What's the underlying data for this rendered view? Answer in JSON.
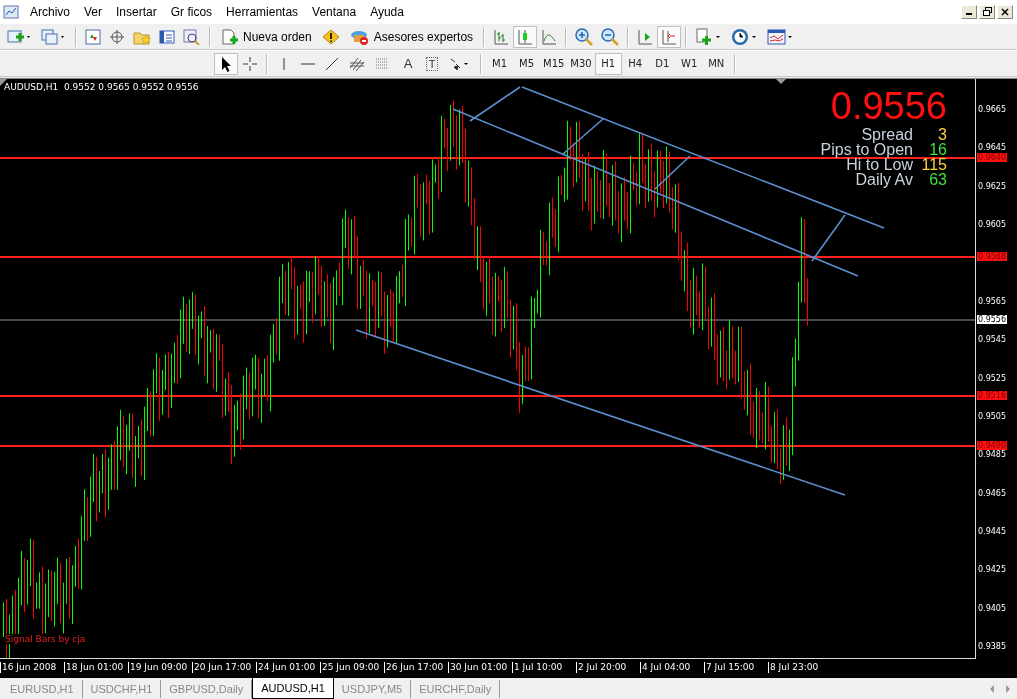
{
  "menu": {
    "items": [
      "Archivo",
      "Ver",
      "Insertar",
      "Gr ficos",
      "Herramientas",
      "Ventana",
      "Ayuda"
    ]
  },
  "toolbar": {
    "new_order": "Nueva orden",
    "experts": "Asesores expertos",
    "chart_types": [
      {
        "selected": false
      },
      {
        "selected": true
      },
      {
        "selected": false
      }
    ],
    "chart_shift": {
      "selected": false
    },
    "auto_scroll": {
      "selected": true
    }
  },
  "drawing_toolbar": {
    "cursor": {
      "selected": true
    },
    "text_tool": "A",
    "label_tool": "T",
    "timeframes": [
      {
        "label": "M1",
        "selected": false
      },
      {
        "label": "M5",
        "selected": false
      },
      {
        "label": "M15",
        "selected": false
      },
      {
        "label": "M30",
        "selected": false
      },
      {
        "label": "H1",
        "selected": true
      },
      {
        "label": "H4",
        "selected": false
      },
      {
        "label": "D1",
        "selected": false
      },
      {
        "label": "W1",
        "selected": false
      },
      {
        "label": "MN",
        "selected": false
      }
    ]
  },
  "chart": {
    "header": "AUDUSD,H1  0.9552 0.9565 0.9552 0.9556",
    "indicator_label": "Signal Bars by cja",
    "info": {
      "price": "0.9556",
      "rows": [
        {
          "label": "Spread",
          "value": "3",
          "color": "#ffd040"
        },
        {
          "label": "Pips to Open",
          "value": "16",
          "color": "#40e040"
        },
        {
          "label": "Hi to Low",
          "value": "115",
          "color": "#ffd040"
        },
        {
          "label": "Daily Av",
          "value": "63",
          "color": "#40e040"
        }
      ]
    },
    "price_ticks": [
      "0.9665",
      "0.9645",
      "0.9625",
      "0.9605",
      "0.9565",
      "0.9545",
      "0.9525",
      "0.9505",
      "0.9485",
      "0.9465",
      "0.9445",
      "0.9425",
      "0.9405",
      "0.9385"
    ],
    "price_tags": [
      {
        "label": "0.9640",
        "kind": "level"
      },
      {
        "label": "0.9588",
        "kind": "level"
      },
      {
        "label": "0.9556",
        "kind": "bid"
      },
      {
        "label": "0.9516",
        "kind": "level"
      },
      {
        "label": "0.9490",
        "kind": "level"
      }
    ],
    "time_ticks": [
      "16 Jun 2008",
      "18 Jun 01:00",
      "19 Jun 09:00",
      "20 Jun 17:00",
      "24 Jun 01:00",
      "25 Jun 09:00",
      "26 Jun 17:00",
      "30 Jun 01:00",
      "1 Jul 10:00",
      "2 Jul 20:00",
      "4 Jul 04:00",
      "7 Jul 15:00",
      "8 Jul 23:00"
    ]
  },
  "tabs": [
    {
      "label": "EURUSD,H1",
      "selected": false
    },
    {
      "label": "USDCHF,H1",
      "selected": false
    },
    {
      "label": "GBPUSD,Daily",
      "selected": false
    },
    {
      "label": "AUDUSD,H1",
      "selected": true
    },
    {
      "label": "USDJPY,M5",
      "selected": false
    },
    {
      "label": "EURCHF,Daily",
      "selected": false
    }
  ]
}
